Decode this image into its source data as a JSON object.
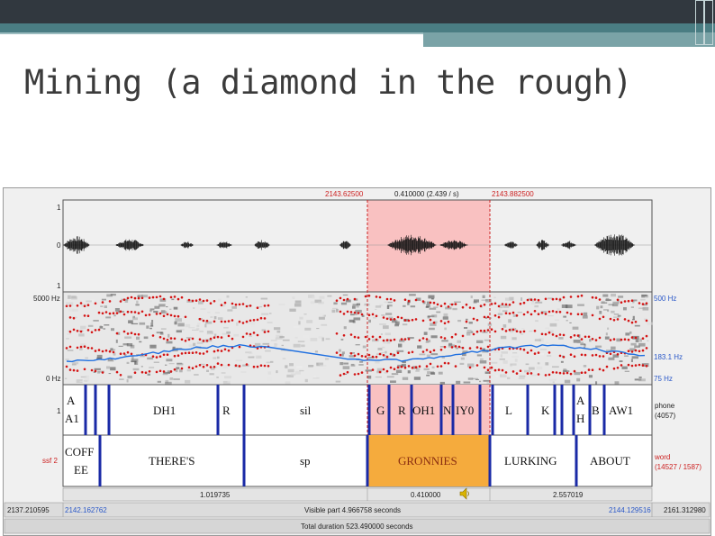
{
  "slide": {
    "title": "Mining (a diamond in the rough)"
  },
  "window": {
    "top_left_time": "2143.62500",
    "top_mid_time": "0.410000 (2.439 / s)",
    "top_right_time": "2143.882500"
  },
  "waveform": {
    "axis_top": "1",
    "axis_mid": "0",
    "axis_bottom": "1"
  },
  "spectrogram": {
    "freq_top": "5000 Hz",
    "freq_bottom": "0 Hz",
    "right_top": "500 Hz",
    "right_mid": "183.1 Hz",
    "right_bottom": "75 Hz"
  },
  "phone_tier": {
    "number": "1",
    "name": "phone",
    "count": "(4057)",
    "labels": {
      "a": "A",
      "a1": "A1",
      "dh1": "DH1",
      "r1": "R",
      "sil": "sil",
      "g": "G",
      "r2": "R",
      "oh1": "OH1",
      "n": "N",
      "iy0": "IY0",
      "l": "L",
      "k": "K",
      "ah": "A",
      "h": "H",
      "b": "B",
      "aw1": "AW1"
    }
  },
  "word_tier": {
    "number": "2",
    "left_label": "ssf 2",
    "name": "word",
    "count": "(14527 / 1587)",
    "labels": {
      "coff": "COFF",
      "ee": "EE",
      "theres": "THERE'S",
      "sp": "sp",
      "gronnies": "GRONNIES",
      "lurking": "LURKING",
      "about": "ABOUT"
    }
  },
  "bottom": {
    "left_dur": "1.019735",
    "mid_dur": "0.410000",
    "right_dur": "2.557019",
    "start_val": "2137.210595",
    "visible_start": "2142.162762",
    "visible_part": "Visible part 4.966758 seconds",
    "visible_end": "2144.129516",
    "end_val": "2161.312980",
    "total": "Total duration 523.490000 seconds"
  },
  "colors": {
    "selection": "#f9c1c1",
    "word_highlight": "#f5ab3d",
    "boundary": "#1a2aa6",
    "formant": "#d41414",
    "pitch": "#1e6fe0"
  }
}
